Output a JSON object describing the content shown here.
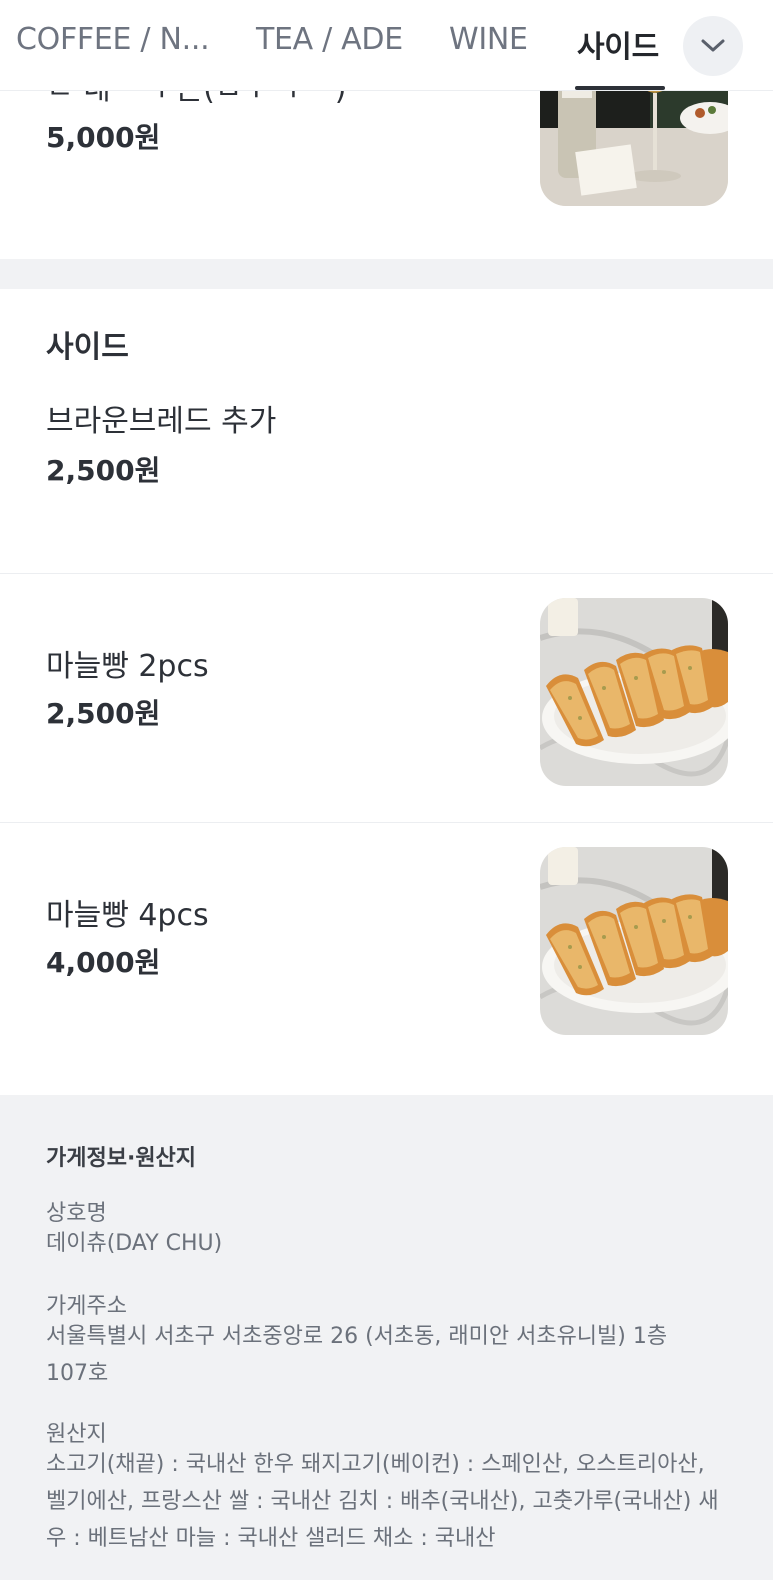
{
  "tabs": [
    {
      "label": "COFFEE / N..."
    },
    {
      "label": "TEA / ADE"
    },
    {
      "label": "WINE"
    },
    {
      "label": "사이드"
    }
  ],
  "active_tab": "사이드",
  "wine_item": {
    "name": "ㄴ 네ㅡ ㅜ든(ㅁㅜ ㅜㅡ)",
    "price": "5,000원"
  },
  "side_section": {
    "title": "사이드",
    "items": [
      {
        "name": "브라운브레드 추가",
        "price": "2,500원"
      },
      {
        "name": "마늘빵 2pcs",
        "price": "2,500원"
      },
      {
        "name": "마늘빵 4pcs",
        "price": "4,000원"
      }
    ]
  },
  "store_info": {
    "title": "가게정보·원산지",
    "name_label": "상호명",
    "name_value": "데이츄(DAY CHU)",
    "address_label": "가게주소",
    "address_value": "서울특별시 서초구 서초중앙로 26 (서초동, 래미안 서초유니빌) 1층 107호",
    "origin_label": "원산지",
    "origin_value": "소고기(채끝) : 국내산 한우 돼지고기(베이컨) : 스페인산, 오스트리아산, 벨기에산, 프랑스산 쌀 : 국내산 김치 : 배추(국내산), 고춧가루(국내산) 새우 : 베트남산 마늘 : 국내산 샐러드 채소 : 국내산"
  }
}
